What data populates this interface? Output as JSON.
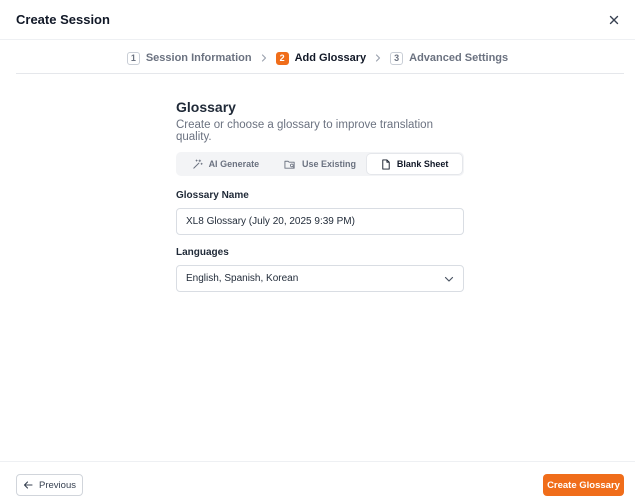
{
  "dialog": {
    "title": "Create Session"
  },
  "stepper": {
    "steps": [
      {
        "num": "1",
        "label": "Session Information",
        "active": false
      },
      {
        "num": "2",
        "label": "Add Glossary",
        "active": true
      },
      {
        "num": "3",
        "label": "Advanced Settings",
        "active": false
      }
    ]
  },
  "glossary": {
    "title": "Glossary",
    "subtitle": "Create or choose a glossary to improve translation quality.",
    "tabs": [
      {
        "label": "AI Generate",
        "icon": "magic-wand-icon"
      },
      {
        "label": "Use Existing",
        "icon": "folder-search-icon"
      },
      {
        "label": "Blank Sheet",
        "icon": "document-icon",
        "active": true
      }
    ],
    "name_label": "Glossary Name",
    "name_value": "XL8 Glossary (July 20, 2025 9:39 PM)",
    "languages_label": "Languages",
    "languages_value": "English, Spanish, Korean"
  },
  "footer": {
    "previous_label": "Previous",
    "create_label": "Create Glossary"
  },
  "colors": {
    "accent": "#f06d1a"
  }
}
